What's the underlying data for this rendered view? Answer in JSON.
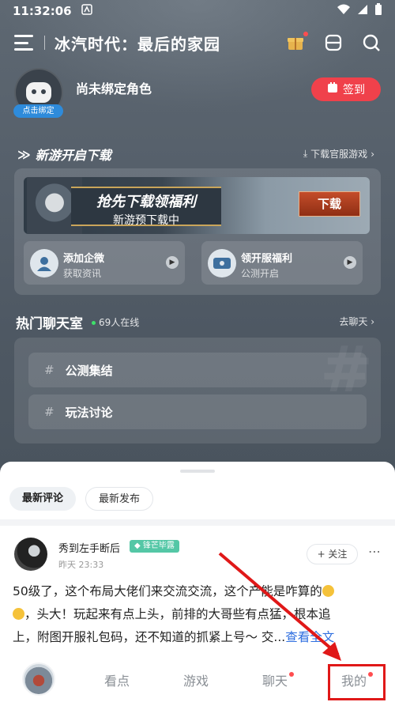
{
  "status_bar": {
    "time": "11:32:06"
  },
  "header": {
    "title": "冰汽时代：最后的家园"
  },
  "profile": {
    "bind_badge": "点击绑定",
    "role_status": "尚未绑定角色",
    "signin_label": "签到"
  },
  "new_game": {
    "section_title": "新游开启下载",
    "download_link": "下载官服游戏",
    "banner": {
      "headline": "抢先下载领福利",
      "subline": "新游预下载中",
      "button": "下载"
    },
    "cards": [
      {
        "title": "添加企微",
        "subtitle": "获取资讯"
      },
      {
        "title": "领开服福利",
        "subtitle": "公测开启"
      }
    ]
  },
  "chat": {
    "title": "热门聊天室",
    "online": "69人在线",
    "go_label": "去聊天",
    "rooms": [
      {
        "label": "公测集结"
      },
      {
        "label": "玩法讨论"
      }
    ]
  },
  "feed": {
    "tabs": [
      {
        "label": "最新评论"
      },
      {
        "label": "最新发布"
      }
    ],
    "post": {
      "username": "秀到左手断后",
      "badge": "锋芒毕露",
      "time": "昨天 23:33",
      "follow": "+ 关注",
      "line1": "50级了，这个布局大佬们来交流交流，这个产能是咋算的",
      "line2": "，头大！玩起来有点上头，前排的大哥些有点猛，根本追",
      "line3a": "上，附图开服礼包码，还不知道的抓紧上号～ 交...",
      "line3b": "查看全文"
    }
  },
  "nav": {
    "items": [
      {
        "label": "看点"
      },
      {
        "label": "游戏"
      },
      {
        "label": "聊天"
      },
      {
        "label": "我的"
      }
    ]
  },
  "colors": {
    "signin": "#f0414b",
    "badge": "#54c7a6",
    "link": "#2f6fe0",
    "annotation": "#e01818"
  }
}
